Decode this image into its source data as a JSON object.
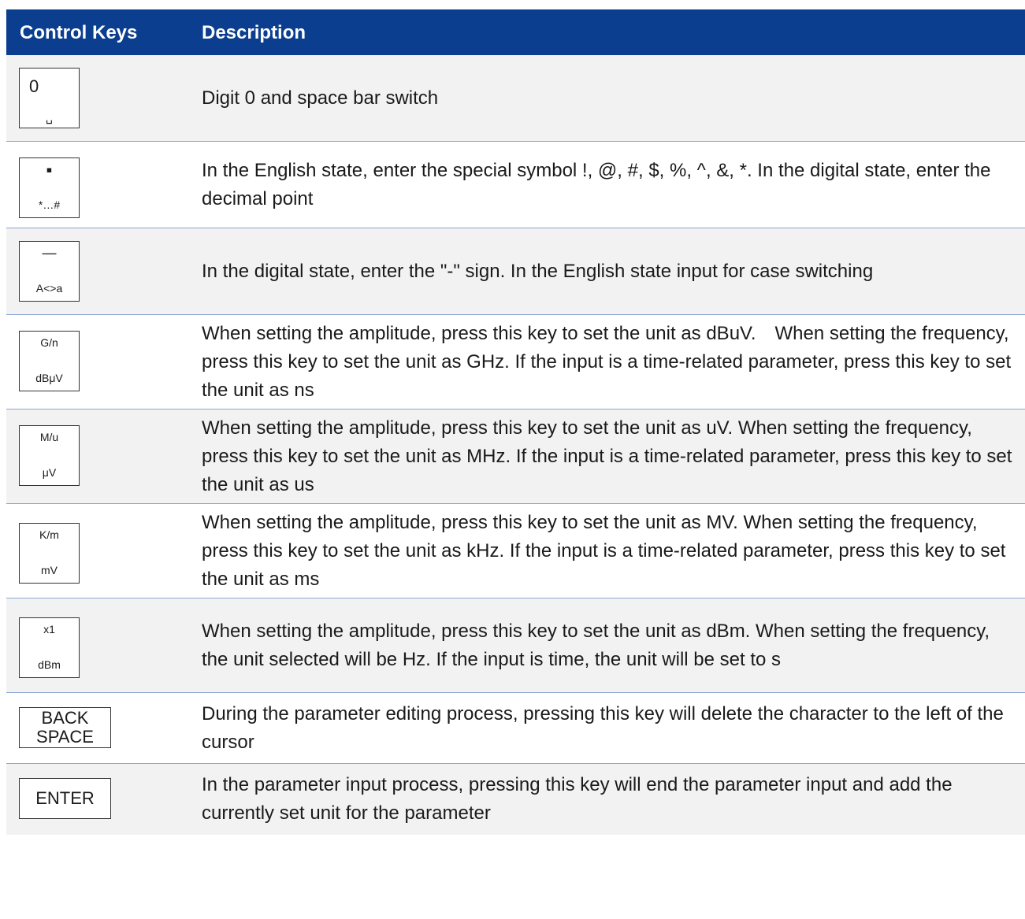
{
  "header": {
    "col1": "Control Keys",
    "col2": "Description"
  },
  "rows": [
    {
      "key_top": "0",
      "key_bottom": "␣",
      "description": "Digit 0 and space bar switch"
    },
    {
      "key_top": "▪",
      "key_bottom": "*…#",
      "description": "In the English state, enter the special symbol !, @, #, $, %, ^, &, *. In the digital state, enter the decimal point"
    },
    {
      "key_top": "—",
      "key_bottom": "A<>a",
      "description": "In the digital state, enter the \"-\" sign. In the English state input for case switching"
    },
    {
      "key_top": "G/n",
      "key_bottom": "dBμV",
      "description": "When setting the amplitude, press this key to set the unit as dBuV.　When setting the frequency, press this key to set the unit as GHz. If the input is a time-related parameter, press this key to set the unit as ns"
    },
    {
      "key_top": "M/u",
      "key_bottom": "μV",
      "description": "When setting the amplitude, press this key to set the unit as uV. When setting the frequency, press this key to set the unit as MHz. If the input is a time-related parameter, press this key to set the unit as us"
    },
    {
      "key_top": "K/m",
      "key_bottom": "mV",
      "description": "When setting the amplitude, press this key to set the unit as MV. When setting the frequency, press this key to set the unit as kHz. If the input is a time-related parameter, press this key to set the unit as ms"
    },
    {
      "key_top": "x1",
      "key_bottom": "dBm",
      "description": "When setting the amplitude, press this key to set the unit as dBm. When setting the frequency, the unit selected will be Hz. If the input is time, the unit will be set to s"
    },
    {
      "key_label": "BACK\nSPACE",
      "description": "During the parameter editing process, pressing this key will delete the character to the left of the cursor"
    },
    {
      "key_label": "ENTER",
      "description": "In the parameter input process, pressing this key will end the parameter input and add the currently set unit for the parameter"
    }
  ]
}
